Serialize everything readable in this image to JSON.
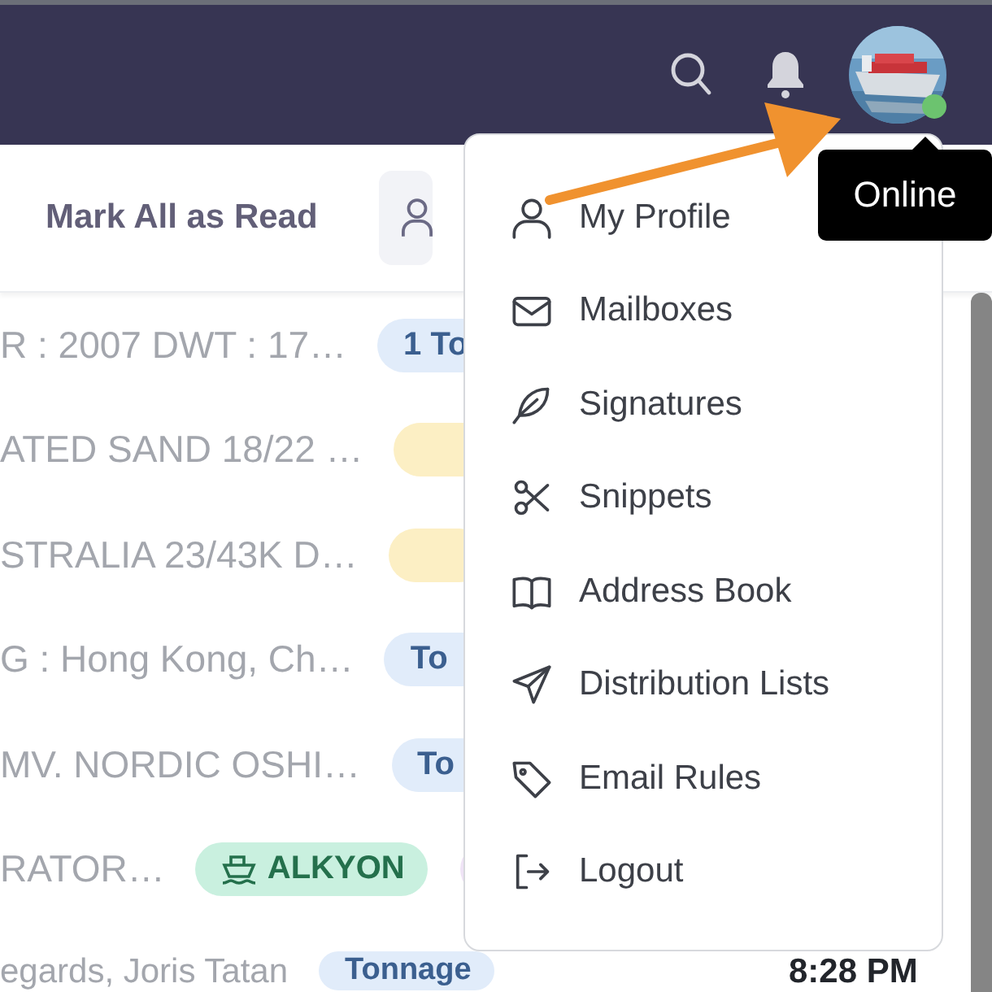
{
  "header": {
    "status": {
      "color": "#6cc36f"
    }
  },
  "toolbar": {
    "mark_all_read": "Mark All as Read"
  },
  "messages": [
    {
      "subject": "R : 2007 DWT : 17…",
      "tags": [
        {
          "label": "1 To",
          "color": "#e1ecfa"
        }
      ]
    },
    {
      "subject": "ATED SAND 18/22 …",
      "tags": [
        {
          "color": "#fcefc4"
        }
      ]
    },
    {
      "subject": "STRALIA 23/43K D…",
      "tags": [
        {
          "color": "#fcefc4"
        }
      ]
    },
    {
      "subject": "G : Hong Kong, Ch…",
      "tags": [
        {
          "label": "To",
          "color": "#e1ecfa"
        }
      ]
    },
    {
      "subject": "MV. NORDIC OSHI…",
      "tags": [
        {
          "label": "To",
          "color": "#e1ecfa"
        }
      ]
    },
    {
      "subject": "RATOR…",
      "tags": [
        {
          "label": "ALKYON",
          "color": "#c9f0df",
          "kind": "vessel"
        },
        {
          "color": "#efe3f6"
        }
      ]
    },
    {
      "subject": "egards, Joris Tatan",
      "tags": [
        {
          "label": "Tonnage",
          "color": "#e1ecfa"
        }
      ],
      "time": "8:28 PM"
    }
  ],
  "user_menu": {
    "items": [
      "My Profile",
      "Mailboxes",
      "Signatures",
      "Snippets",
      "Address Book",
      "Distribution Lists",
      "Email Rules",
      "Logout"
    ]
  },
  "tooltip": "Online"
}
